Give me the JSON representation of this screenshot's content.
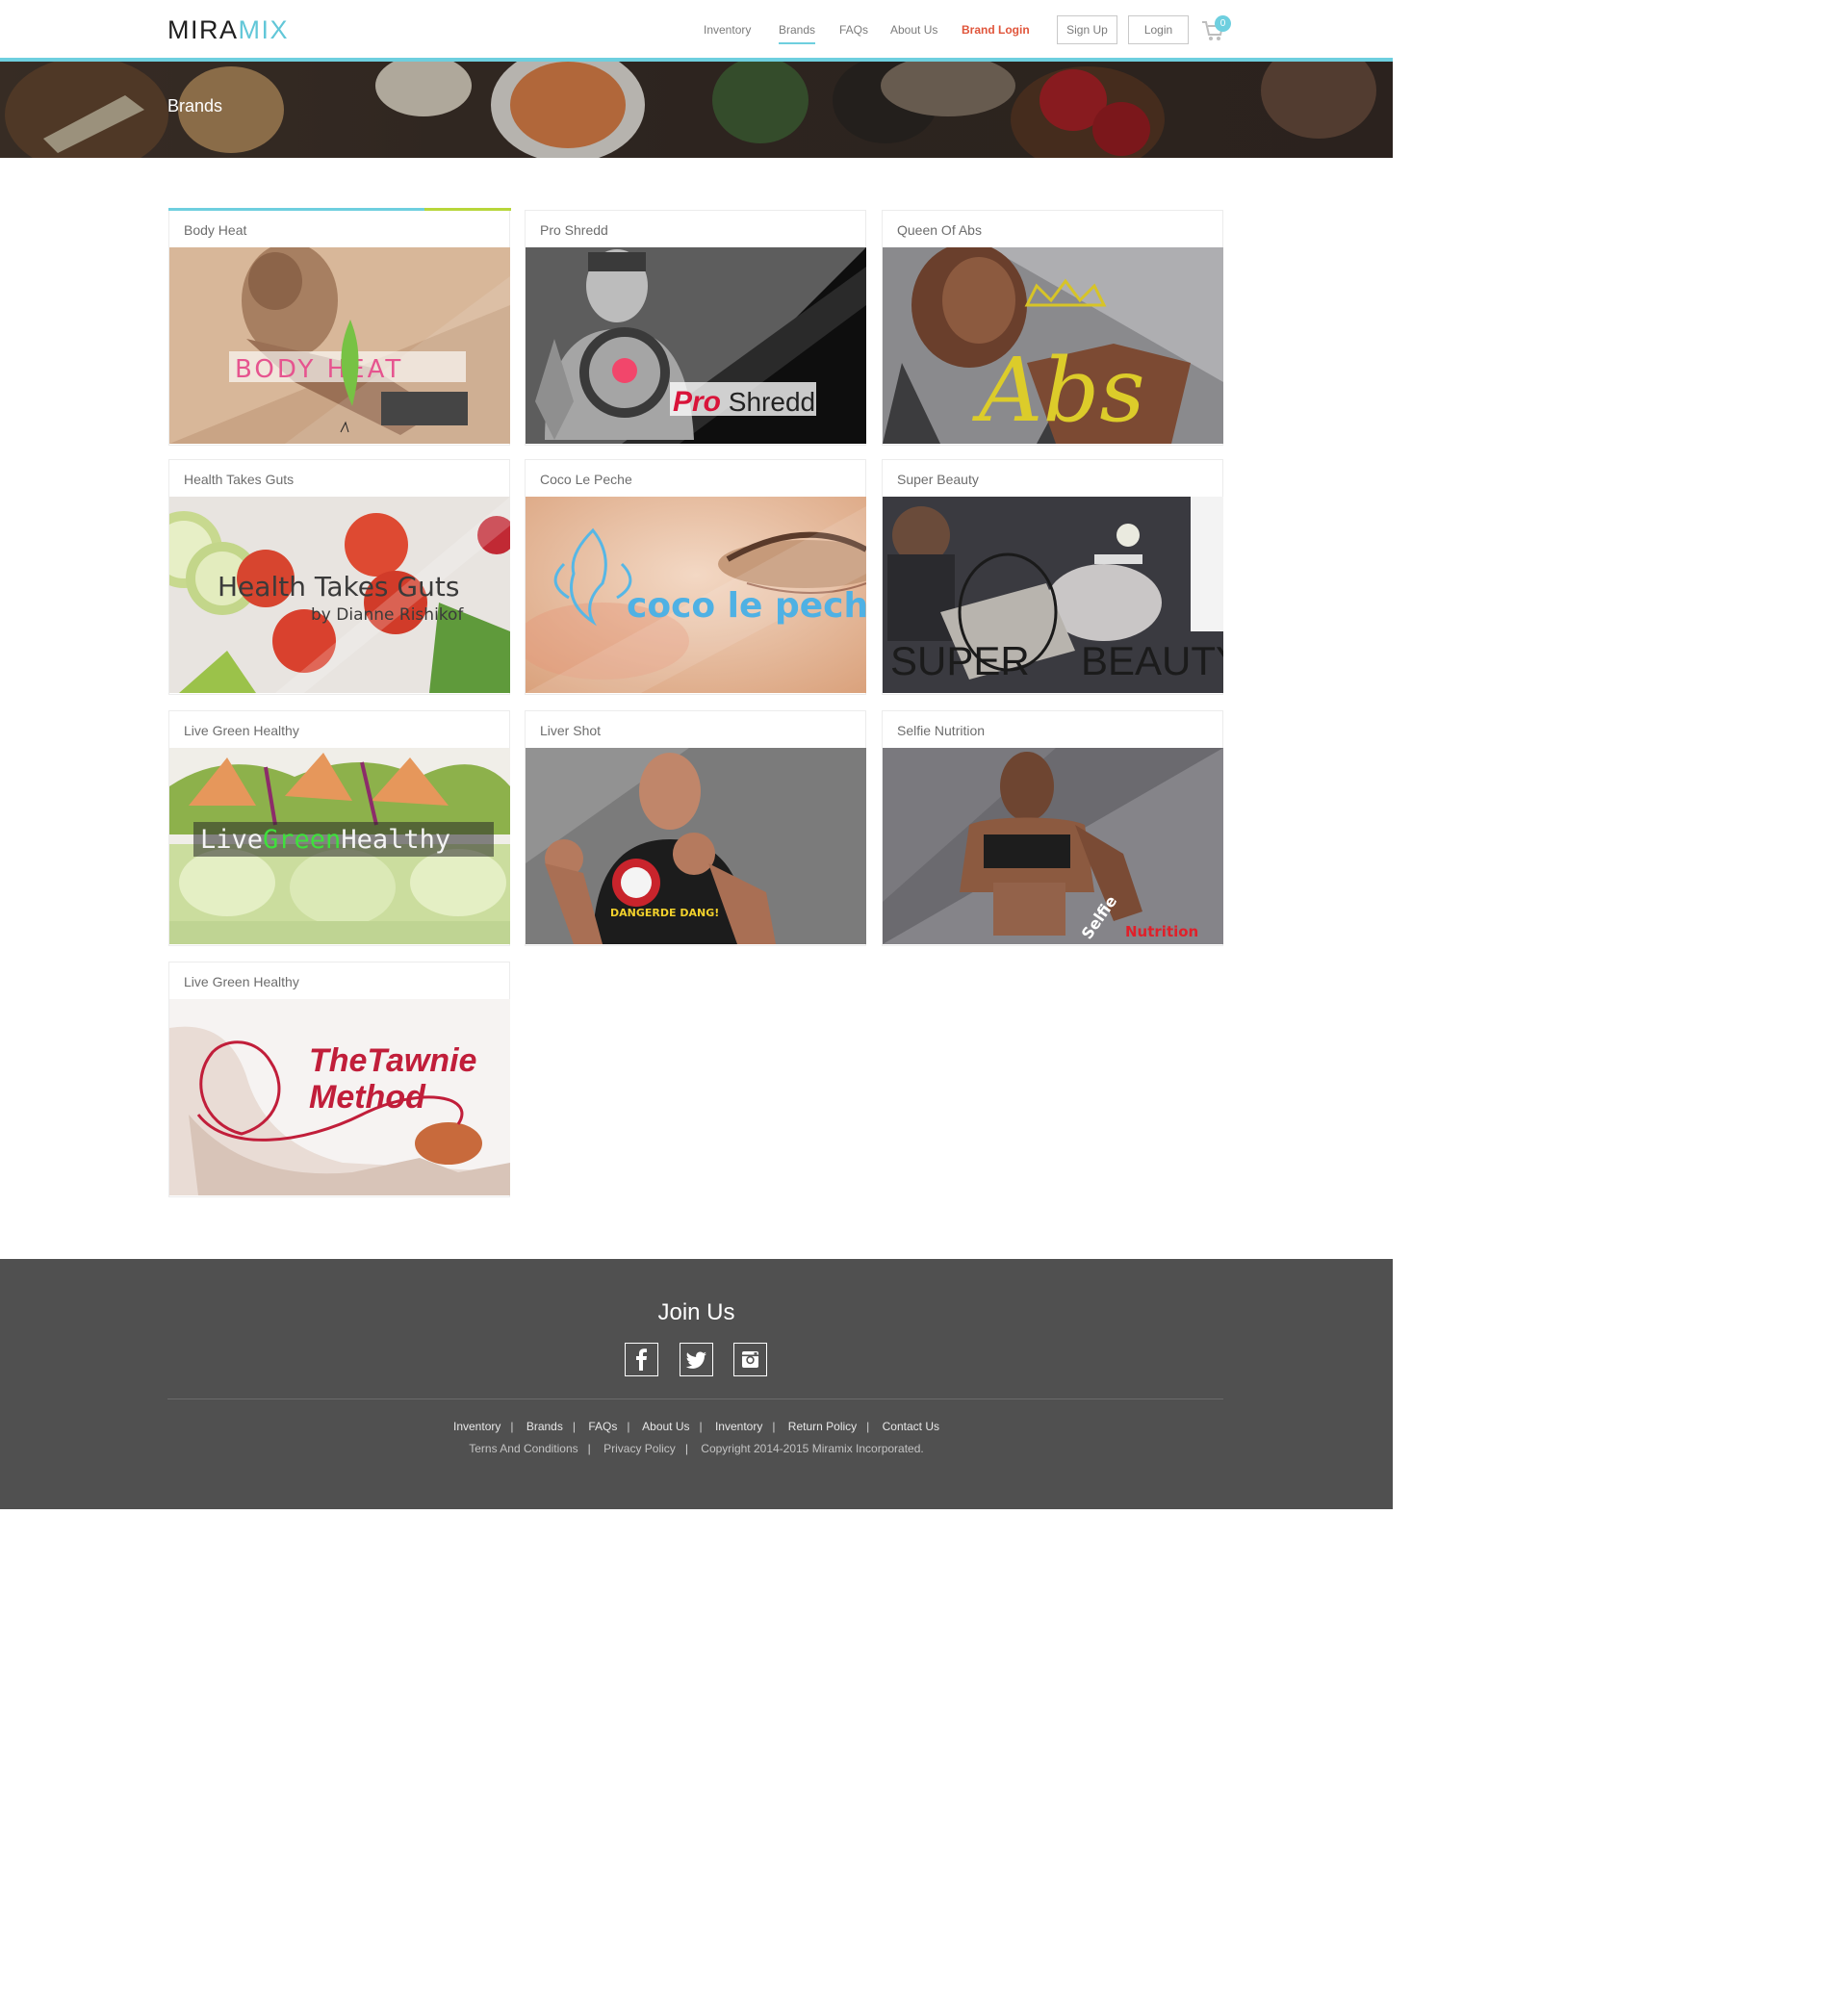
{
  "brand": {
    "logo_part1": "MIRA",
    "logo_part2": "MIX"
  },
  "nav": {
    "items": [
      "Inventory",
      "Brands",
      "FAQs",
      "About Us",
      "Brand Login"
    ],
    "active": "Brands"
  },
  "header_buttons": {
    "signup": "Sign Up",
    "login": "Login"
  },
  "cart": {
    "count": "0"
  },
  "hero": {
    "title": "Brands"
  },
  "brands": [
    {
      "title": "Body Heat",
      "image_text": "BODY HEAT"
    },
    {
      "title": "Pro Shredd",
      "image_text_1": "Pro",
      "image_text_2": " Shredd"
    },
    {
      "title": "Queen Of Abs",
      "image_text": "Abs"
    },
    {
      "title": "Health Takes Guts",
      "image_text": "Health Takes Guts",
      "image_subtext": "by Dianne Rishikof"
    },
    {
      "title": "Coco Le Peche",
      "image_text": "coco le peche"
    },
    {
      "title": "Super Beauty",
      "image_text_1": "SUPER",
      "image_text_2": "BEAUTY"
    },
    {
      "title": "Live Green Healthy",
      "image_text_1": "Live",
      "image_text_2": "Green",
      "image_text_3": "Healthy"
    },
    {
      "title": "Liver Shot",
      "image_text": "DANGERDE DANG!"
    },
    {
      "title": "Selfie Nutrition",
      "image_text_1": "Selfie",
      "image_text_2": "Nutrition"
    },
    {
      "title": "Live Green Healthy",
      "image_text_1": "TheTawnie",
      "image_text_2": "Method"
    }
  ],
  "footer": {
    "title": "Join Us",
    "social": [
      "facebook-icon",
      "twitter-icon",
      "instagram-icon"
    ],
    "links": [
      "Inventory",
      "Brands",
      "FAQs",
      "About Us",
      "Inventory",
      "Return Policy",
      "Contact Us"
    ],
    "legal": [
      "Terns And Conditions",
      "Privacy Policy",
      "Copyright 2014-2015 Miramix Incorporated."
    ]
  },
  "colors": {
    "accent": "#6ecfdf",
    "accent_green": "#b7d63a",
    "brand_login": "#e0553b",
    "footer_bg": "#505050"
  }
}
